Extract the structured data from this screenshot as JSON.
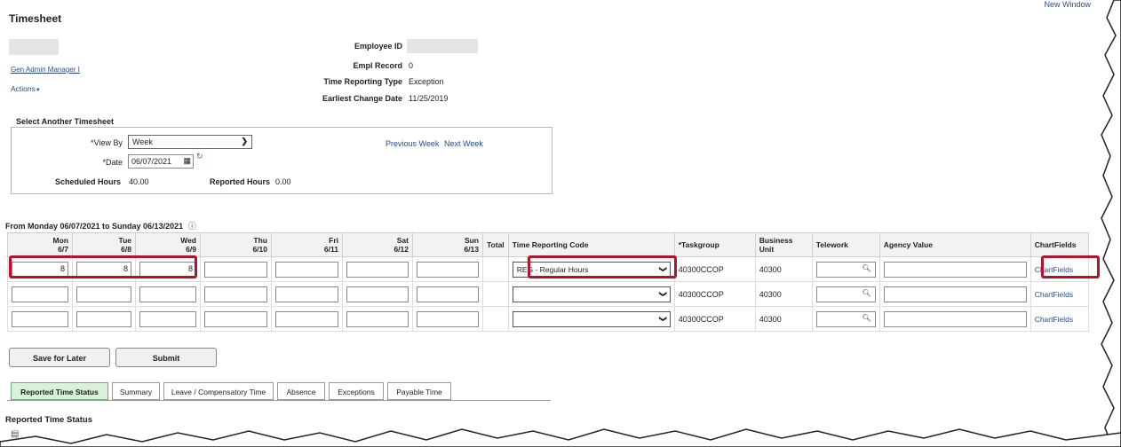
{
  "page": {
    "title": "Timesheet",
    "new_window": "New Window",
    "job_title": "Gen Admin Manager I",
    "actions": "Actions"
  },
  "employee": {
    "id_label": "Employee ID",
    "empl_record_label": "Empl Record",
    "empl_record_value": "0",
    "trt_label": "Time Reporting Type",
    "trt_value": "Exception",
    "ecd_label": "Earliest Change Date",
    "ecd_value": "11/25/2019"
  },
  "select_timesheet": {
    "heading": "Select Another Timesheet",
    "view_by_label": "*View By",
    "view_by_value": "Week",
    "date_label": "*Date",
    "date_value": "06/07/2021",
    "prev_week": "Previous Week",
    "next_week": "Next Week",
    "scheduled_label": "Scheduled Hours",
    "scheduled_value": "40.00",
    "reported_label": "Reported Hours",
    "reported_value": "0.00"
  },
  "grid": {
    "range": "From Monday 06/07/2021 to Sunday 06/13/2021",
    "days": [
      {
        "day": "Mon",
        "date": "6/7"
      },
      {
        "day": "Tue",
        "date": "6/8"
      },
      {
        "day": "Wed",
        "date": "6/9"
      },
      {
        "day": "Thu",
        "date": "6/10"
      },
      {
        "day": "Fri",
        "date": "6/11"
      },
      {
        "day": "Sat",
        "date": "6/12"
      },
      {
        "day": "Sun",
        "date": "6/13"
      }
    ],
    "headers": {
      "total": "Total",
      "trc": "Time Reporting Code",
      "taskgroup": "*Taskgroup",
      "bu_line1": "Business",
      "bu_line2": "Unit",
      "telework": "Telework",
      "agency": "Agency Value",
      "chartfields": "ChartFields"
    },
    "rows": [
      {
        "hours": [
          "8",
          "8",
          "8",
          "",
          "",
          "",
          ""
        ],
        "trc": "REG - Regular Hours",
        "taskgroup": "40300CCOP",
        "bu": "40300",
        "chartfields": "ChartFields"
      },
      {
        "hours": [
          "",
          "",
          "",
          "",
          "",
          "",
          ""
        ],
        "trc": "",
        "taskgroup": "40300CCOP",
        "bu": "40300",
        "chartfields": "ChartFields"
      },
      {
        "hours": [
          "",
          "",
          "",
          "",
          "",
          "",
          ""
        ],
        "trc": "",
        "taskgroup": "40300CCOP",
        "bu": "40300",
        "chartfields": "ChartFields"
      }
    ]
  },
  "buttons": {
    "save": "Save for Later",
    "submit": "Submit"
  },
  "tabs": [
    "Reported Time Status",
    "Summary",
    "Leave / Compensatory Time",
    "Absence",
    "Exceptions",
    "Payable Time"
  ],
  "reported_time_status_heading": "Reported Time Status",
  "colors": {
    "highlight": "#b3142c",
    "link": "#2a4b8d",
    "active_tab": "#d9f0d9"
  }
}
